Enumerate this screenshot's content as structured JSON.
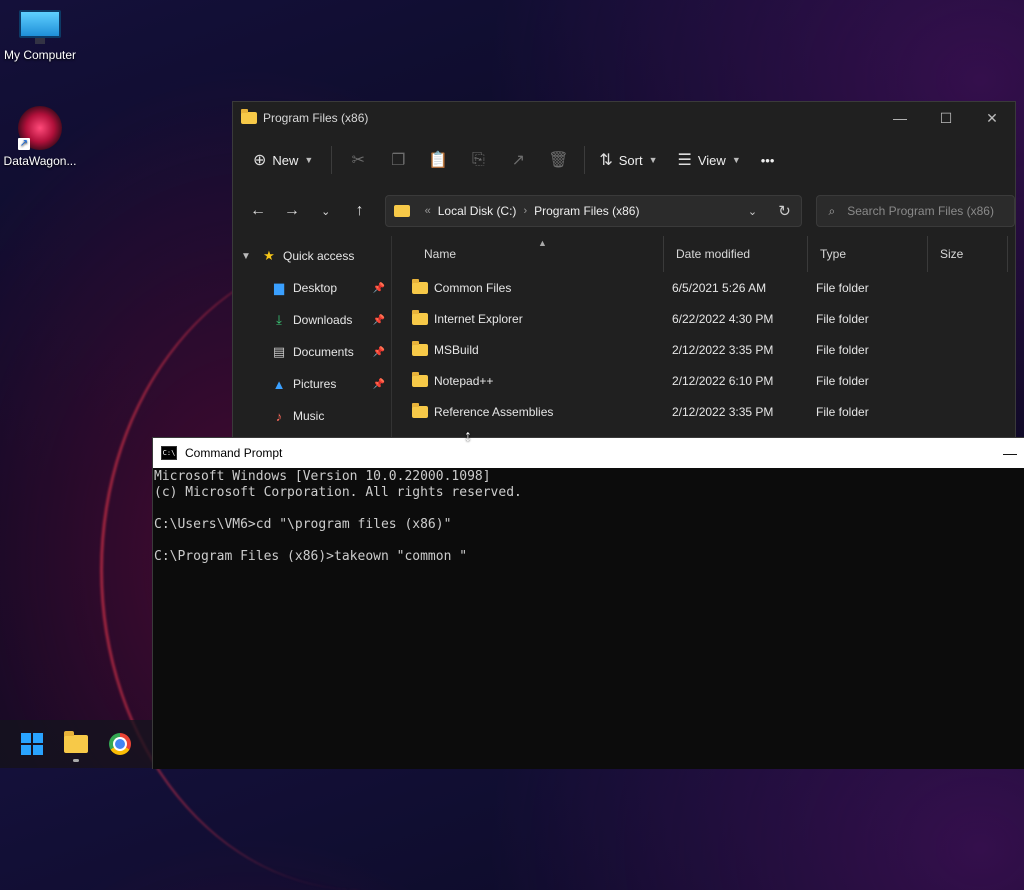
{
  "desktop": {
    "icons": [
      {
        "label": "My Computer"
      },
      {
        "label": "DataWagon..."
      }
    ]
  },
  "explorer": {
    "title": "Program Files (x86)",
    "toolbar": {
      "new_label": "New",
      "sort_label": "Sort",
      "view_label": "View",
      "more_label": "•••"
    },
    "address": {
      "crumbs": [
        "Local Disk (C:)",
        "Program Files (x86)"
      ]
    },
    "search": {
      "placeholder": "Search Program Files (x86)"
    },
    "sidebar": {
      "quick_access": "Quick access",
      "items": [
        {
          "label": "Desktop",
          "icon": "desktop-icon"
        },
        {
          "label": "Downloads",
          "icon": "download-icon"
        },
        {
          "label": "Documents",
          "icon": "document-icon"
        },
        {
          "label": "Pictures",
          "icon": "picture-icon"
        },
        {
          "label": "Music",
          "icon": "music-icon"
        }
      ]
    },
    "columns": [
      "Name",
      "Date modified",
      "Type",
      "Size"
    ],
    "rows": [
      {
        "name": "Common Files",
        "date": "6/5/2021 5:26 AM",
        "type": "File folder"
      },
      {
        "name": "Internet Explorer",
        "date": "6/22/2022 4:30 PM",
        "type": "File folder"
      },
      {
        "name": "MSBuild",
        "date": "2/12/2022 3:35 PM",
        "type": "File folder"
      },
      {
        "name": "Notepad++",
        "date": "2/12/2022 6:10 PM",
        "type": "File folder"
      },
      {
        "name": "Reference Assemblies",
        "date": "2/12/2022 3:35 PM",
        "type": "File folder"
      }
    ]
  },
  "cmd": {
    "title": "Command Prompt",
    "lines": [
      "Microsoft Windows [Version 10.0.22000.1098]",
      "(c) Microsoft Corporation. All rights reserved.",
      "",
      "C:\\Users\\VM6>cd \"\\program files (x86)\"",
      "",
      "C:\\Program Files (x86)>takeown \"common \""
    ]
  },
  "taskbar": {
    "items": [
      "start-button",
      "file-explorer",
      "chrome"
    ]
  }
}
